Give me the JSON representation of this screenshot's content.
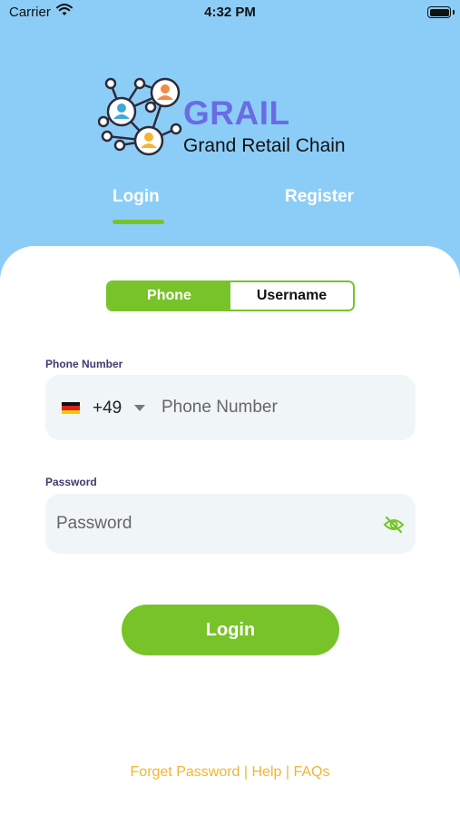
{
  "status_bar": {
    "carrier": "Carrier",
    "time": "4:32 PM",
    "icons": [
      "wifi-icon",
      "battery-icon"
    ]
  },
  "brand": {
    "name": "GRAIL",
    "tagline": "Grand Retail Chain",
    "name_color": "#6b6be6"
  },
  "auth_tabs": {
    "login": "Login",
    "register": "Register",
    "active": "login"
  },
  "login_method": {
    "phone": "Phone",
    "username": "Username",
    "active": "phone"
  },
  "phone": {
    "label": "Phone Number",
    "country_code": "+49",
    "flag": "germany-flag-icon",
    "placeholder": "Phone Number",
    "value": ""
  },
  "password": {
    "label": "Password",
    "placeholder": "Password",
    "value": "",
    "toggle_icon": "eye-off-icon"
  },
  "submit": {
    "label": "Login"
  },
  "footer": {
    "forget_password": "Forget Password",
    "help": "Help",
    "faqs": "FAQs",
    "separator": " | "
  },
  "colors": {
    "background": "#8ccdf8",
    "accent": "#78c32a",
    "link": "#f3b431",
    "label": "#3d3a6e"
  }
}
